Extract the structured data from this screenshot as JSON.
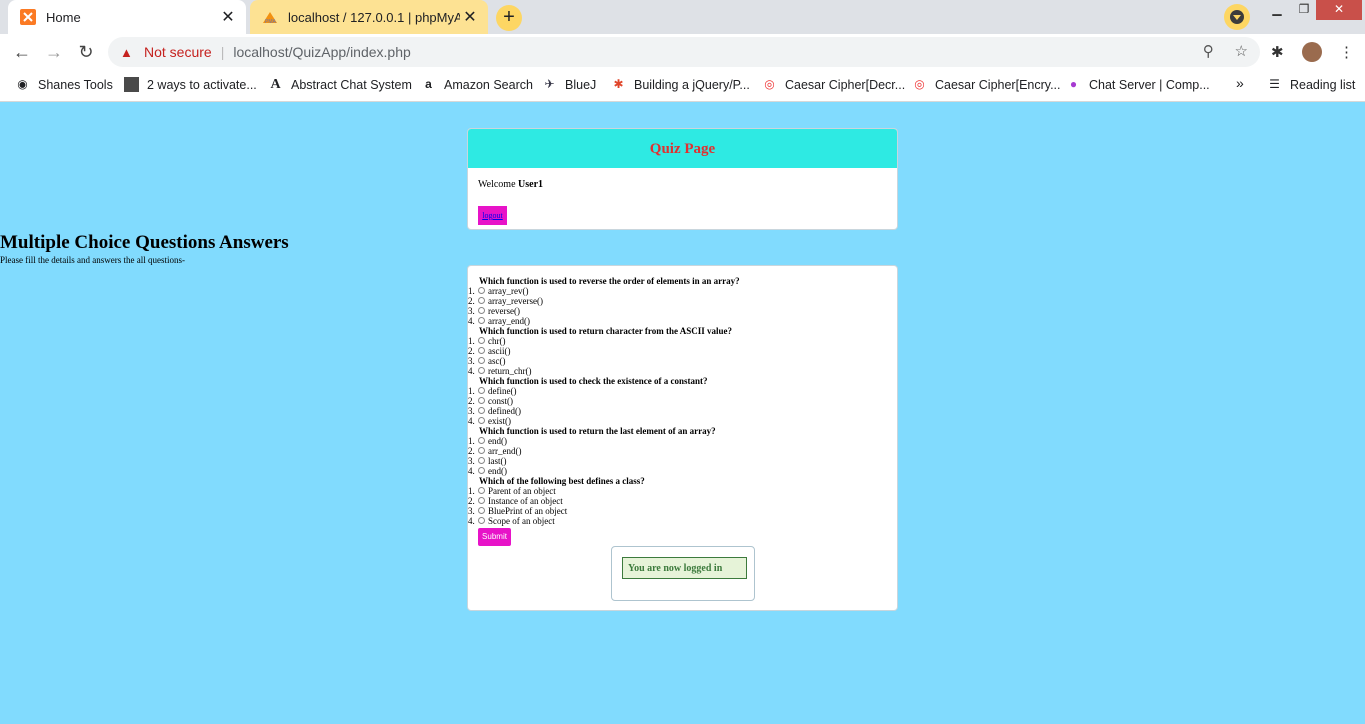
{
  "browser": {
    "tabs": [
      {
        "title": "Home",
        "icon": "xampp-icon"
      },
      {
        "title": "localhost / 127.0.0.1 | phpMyAdmin",
        "icon": "phpmyadmin-icon"
      }
    ],
    "security_label": "Not secure",
    "url": "localhost/QuizApp/index.php",
    "bookmarks": [
      "Shanes Tools",
      "2 ways to activate...",
      "Abstract Chat System",
      "Amazon Search",
      "BlueJ",
      "Building a jQuery/P...",
      "Caesar Cipher[Decr...",
      "Caesar Cipher[Encry...",
      "Chat Server | Comp..."
    ],
    "more_bookmarks": "»",
    "reading_list": "Reading list"
  },
  "page": {
    "header_title": "Quiz Page",
    "welcome_text": "Welcome",
    "username": "User1",
    "logout_label": "logout",
    "mcq_title": "Multiple Choice Questions Answers",
    "mcq_subtitle": "Please fill the details and answers the all questions-",
    "submit_label": "Submit",
    "status_message": "You are now logged in"
  },
  "questions": [
    {
      "text": "Which function is used to reverse the order of elements in an array?",
      "options": [
        "array_rev()",
        "array_reverse()",
        "reverse()",
        "array_end()"
      ]
    },
    {
      "text": "Which function is used to return character from the ASCII value?",
      "options": [
        "chr()",
        "ascii()",
        "asc()",
        "return_chr()"
      ]
    },
    {
      "text": "Which function is used to check the existence of a constant?",
      "options": [
        "define()",
        "const()",
        "defined()",
        "exist()"
      ]
    },
    {
      "text": "Which function is used to return the last element of an array?",
      "options": [
        "end()",
        "arr_end()",
        "last()",
        "end()"
      ]
    },
    {
      "text": "Which of the following best defines a class?",
      "options": [
        "Parent of an object",
        "Instance of an object",
        "BluePrint of an object",
        "Scope of an object"
      ]
    }
  ]
}
